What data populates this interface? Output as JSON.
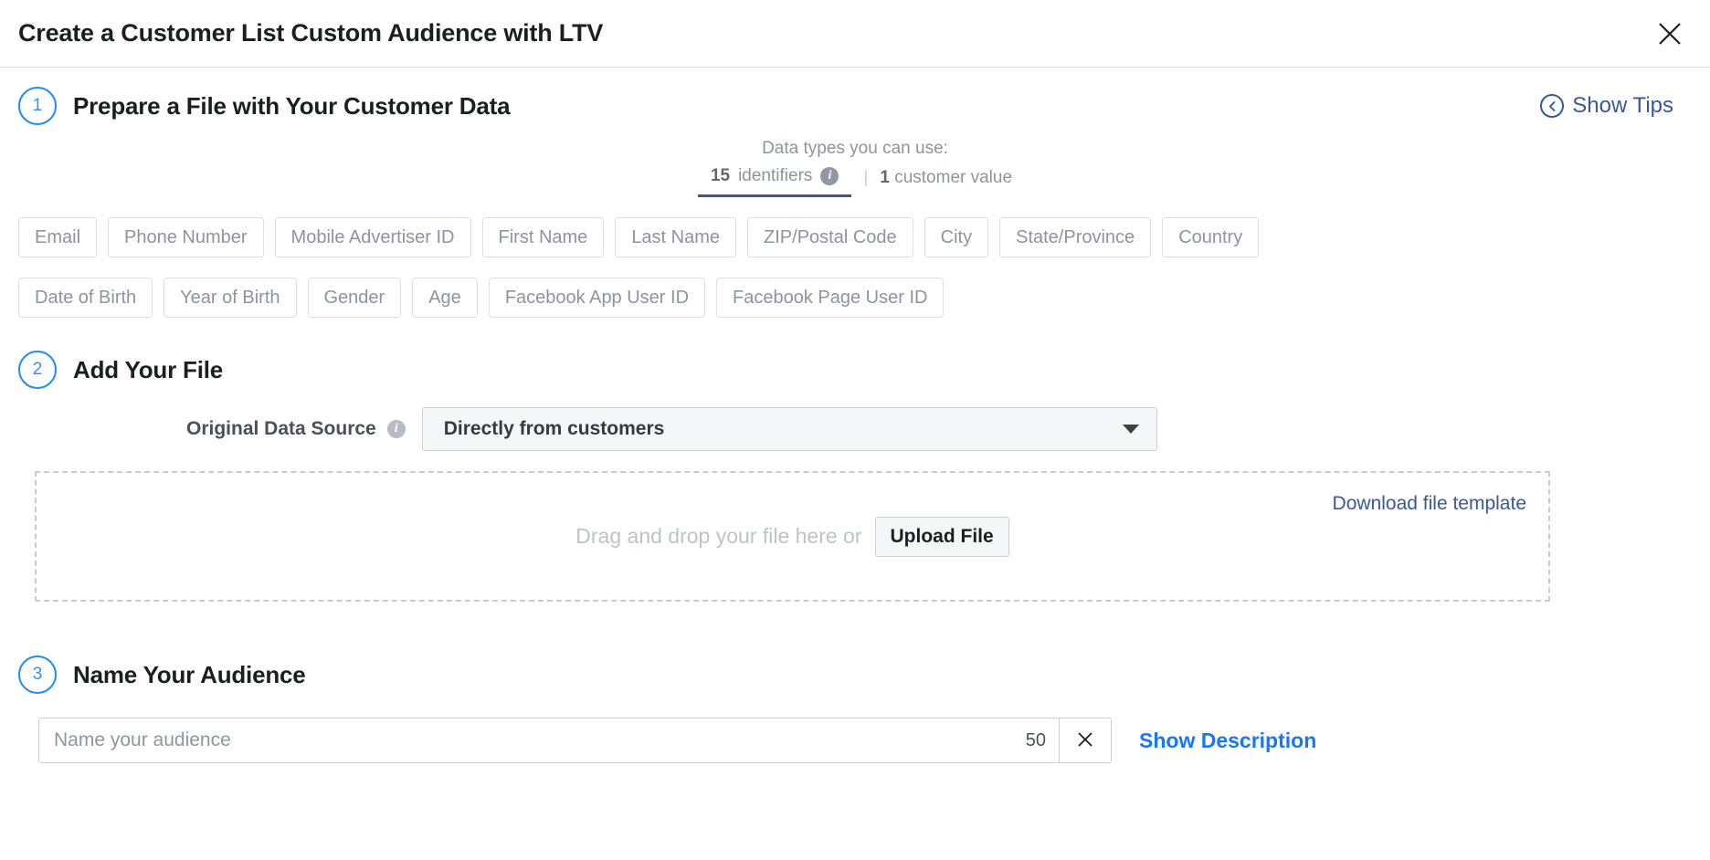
{
  "header": {
    "title": "Create a Customer List Custom Audience with LTV",
    "close_icon": "close-icon"
  },
  "step1": {
    "number": "1",
    "title": "Prepare a File with Your Customer Data",
    "show_tips": {
      "label": "Show Tips",
      "icon": "chevron-left-circle-icon"
    },
    "datatypes": {
      "label": "Data types you can use:",
      "identifiers_count": "15",
      "identifiers_label": "identifiers",
      "info_icon": "info-icon",
      "divider": "|",
      "customer_value_count": "1",
      "customer_value_label": "customer value"
    },
    "chips_row1": [
      "Email",
      "Phone Number",
      "Mobile Advertiser ID",
      "First Name",
      "Last Name",
      "ZIP/Postal Code",
      "City",
      "State/Province",
      "Country"
    ],
    "chips_row2": [
      "Date of Birth",
      "Year of Birth",
      "Gender",
      "Age",
      "Facebook App User ID",
      "Facebook Page User ID"
    ]
  },
  "step2": {
    "number": "2",
    "title": "Add Your File",
    "data_source": {
      "label": "Original Data Source",
      "info_icon": "info-icon",
      "selected": "Directly from customers",
      "caret_icon": "chevron-down-icon"
    },
    "dropzone": {
      "text": "Drag and drop your file here or",
      "upload_button": "Upload File",
      "download_template": "Download file template"
    }
  },
  "step3": {
    "number": "3",
    "title": "Name Your Audience",
    "name_input": {
      "value": "",
      "placeholder": "Name your audience",
      "char_remaining": "50",
      "clear_icon": "close-icon"
    },
    "show_description": "Show Description"
  },
  "colors": {
    "accent_blue": "#1877f2",
    "link_blue": "#385898",
    "step_circle": "#1f8df7",
    "chip_text": "#8d949e",
    "underline": "#3b5998"
  }
}
